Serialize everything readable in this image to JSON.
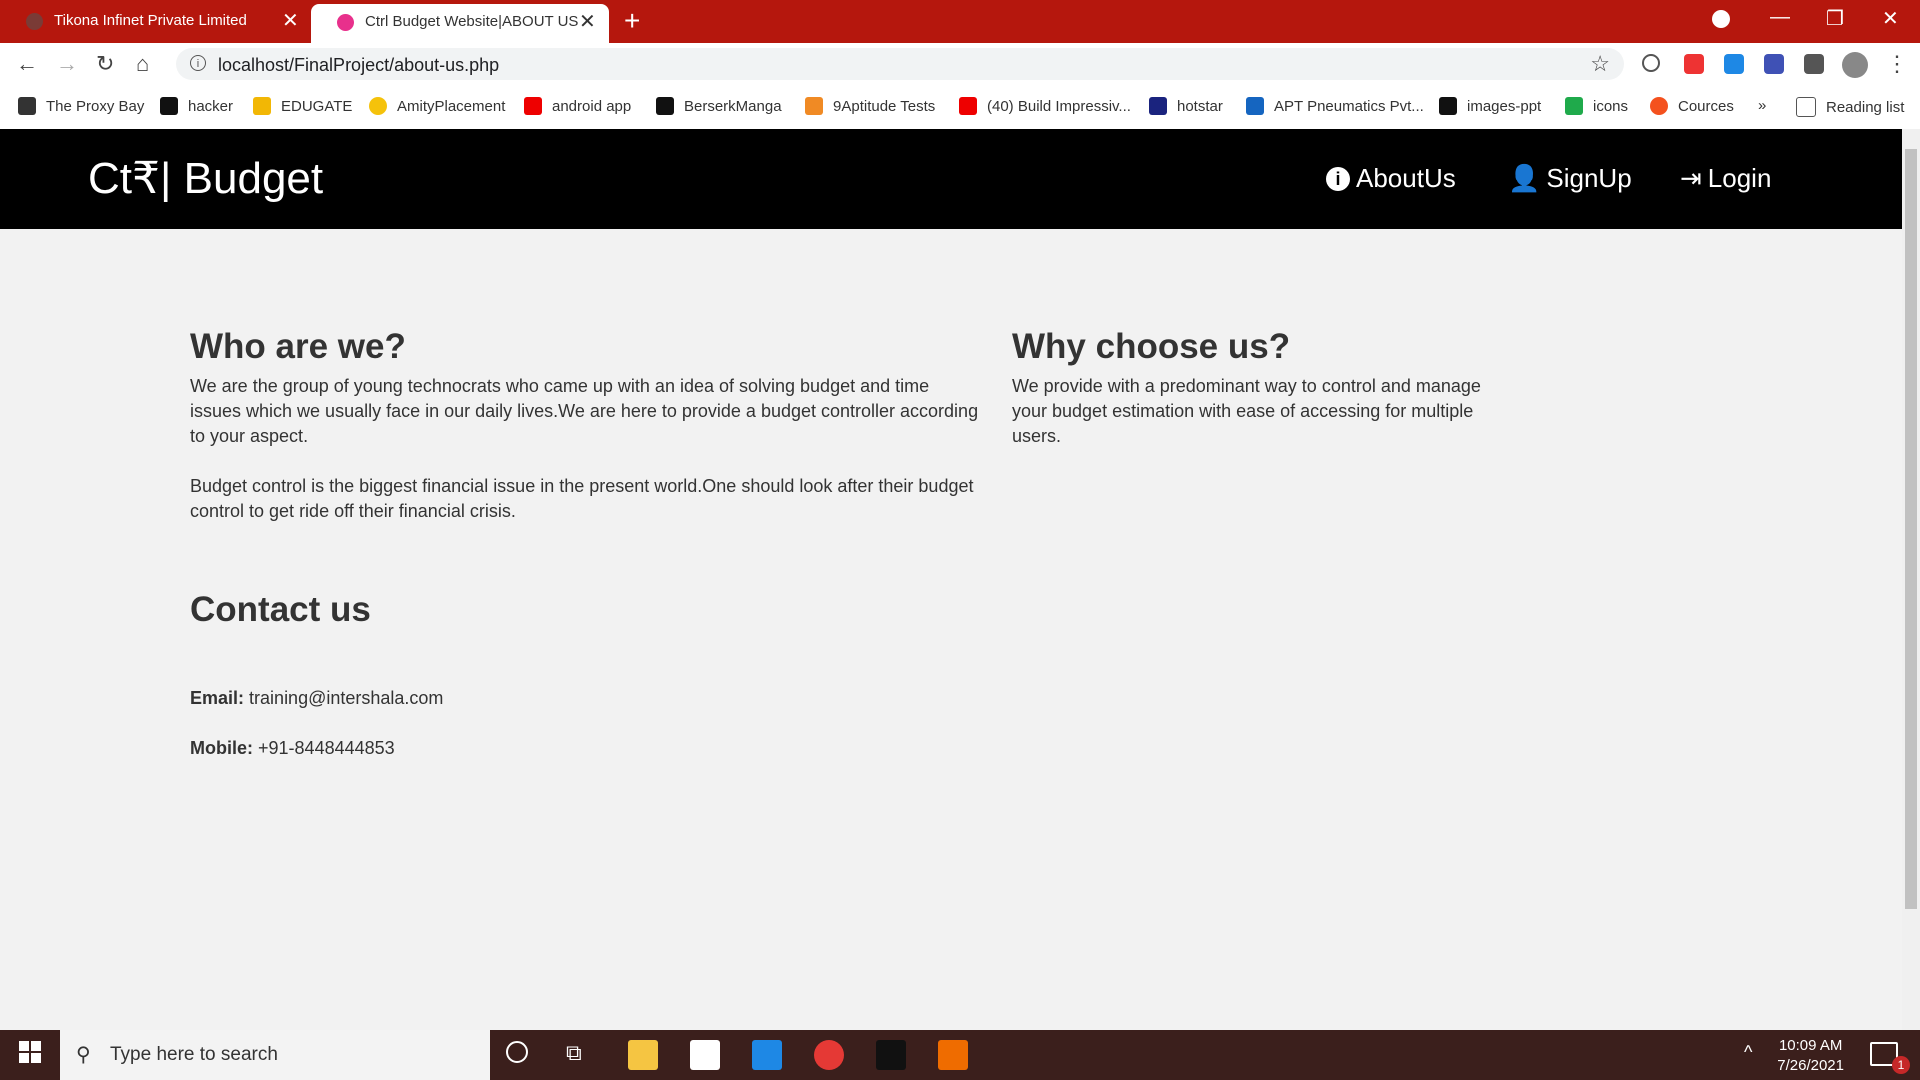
{
  "browser": {
    "tabs": [
      {
        "title": "Tikona Infinet Private Limited",
        "active": false
      },
      {
        "title": "Ctrl Budget Website|ABOUT US",
        "active": true
      }
    ],
    "url": "localhost/FinalProject/about-us.php",
    "bookmarks": [
      "The Proxy Bay",
      "hacker",
      "EDUGATE",
      "AmityPlacement",
      "android app",
      "BerserkManga",
      "9Aptitude Tests",
      "(40) Build Impressiv...",
      "hotstar",
      "APT Pneumatics Pvt...",
      "images-ppt",
      "icons",
      "Cources"
    ],
    "more_bookmarks": "»",
    "reading_list": "Reading list",
    "chrome_color": "#b5170d"
  },
  "site": {
    "brand": "Ct₹| Budget",
    "nav": [
      {
        "label": "AboutUs",
        "icon": "info-icon"
      },
      {
        "label": "SignUp",
        "icon": "user-icon"
      },
      {
        "label": "Login",
        "icon": "login-icon"
      }
    ]
  },
  "about": {
    "who_title": "Who are we?",
    "who_p1": "We are the group of young technocrats who came up with an idea of solving budget and time issues which we usually face in our daily lives.We are here to provide a budget controller according to your aspect.",
    "who_p2": "Budget control is the biggest financial issue in the present world.One should look after their budget control to get ride off their financial crisis.",
    "why_title": "Why choose us?",
    "why_p1": "We provide with a predominant way to control and manage your budget estimation with ease of accessing for multiple users.",
    "contact_title": "Contact us",
    "email_label": "Email:",
    "email_value": "training@intershala.com",
    "mobile_label": "Mobile:",
    "mobile_value": "+91-8448444853"
  },
  "taskbar": {
    "search_placeholder": "Type here to search",
    "time": "10:09 AM",
    "date": "7/26/2021",
    "notifications": "1"
  }
}
